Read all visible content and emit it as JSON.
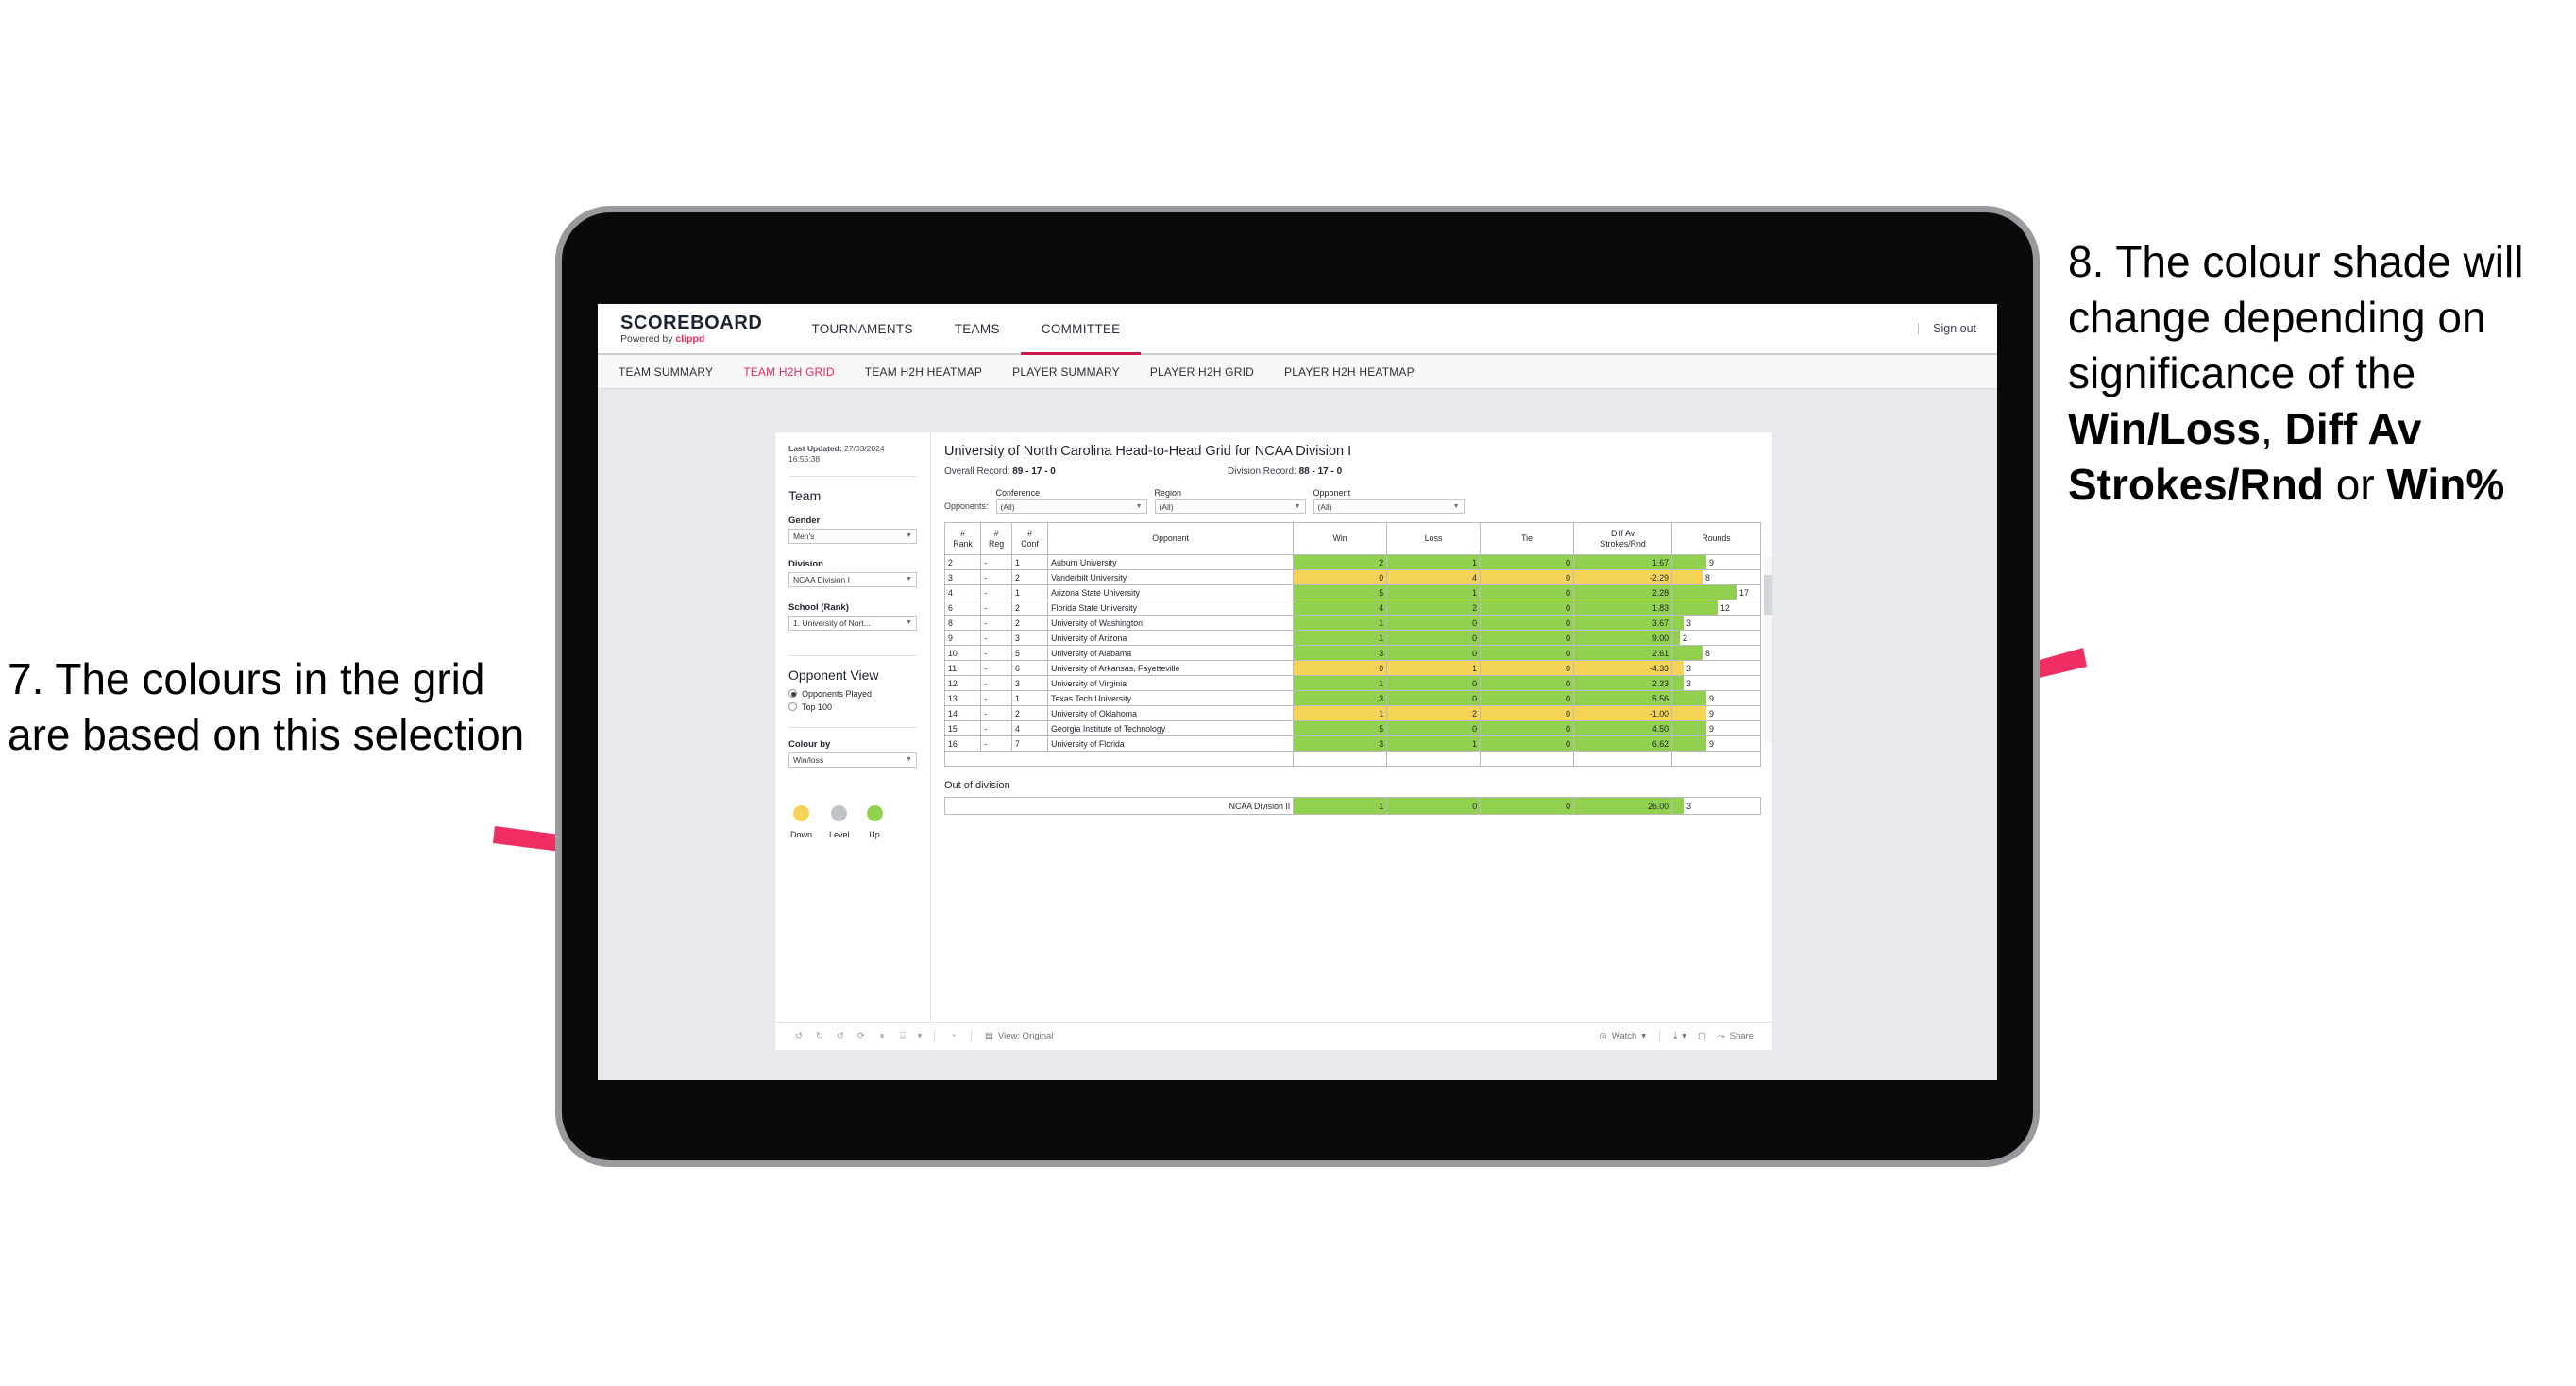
{
  "annotations": {
    "left": {
      "text": "7. The colours in the grid are based on this selection",
      "arrow_color": "#ef2e63"
    },
    "right": {
      "line1": "8. The colour shade will change depending on significance of the ",
      "bold1": "Win/Loss",
      "mid1": ", ",
      "bold2": "Diff Av Strokes/Rnd",
      "mid2": " or ",
      "bold3": "Win%",
      "arrow_color": "#ef2e63"
    }
  },
  "app": {
    "brand_title": "SCOREBOARD",
    "brand_sub_prefix": "Powered by ",
    "brand_sub_accent": "clippd",
    "accent_color": "#e8275a",
    "top_nav": [
      {
        "label": "TOURNAMENTS",
        "active": false
      },
      {
        "label": "TEAMS",
        "active": false
      },
      {
        "label": "COMMITTEE",
        "active": true
      }
    ],
    "sign_out": "Sign out",
    "sub_nav": [
      {
        "label": "TEAM SUMMARY",
        "active": false
      },
      {
        "label": "TEAM H2H GRID",
        "active": true
      },
      {
        "label": "TEAM H2H HEATMAP",
        "active": false
      },
      {
        "label": "PLAYER SUMMARY",
        "active": false
      },
      {
        "label": "PLAYER H2H GRID",
        "active": false
      },
      {
        "label": "PLAYER H2H HEATMAP",
        "active": false
      }
    ]
  },
  "filters": {
    "last_updated_label": "Last Updated: ",
    "last_updated_value": "27/03/2024 16:55:38",
    "team_heading": "Team",
    "gender_label": "Gender",
    "gender_value": "Men's",
    "division_label": "Division",
    "division_value": "NCAA Division I",
    "school_label": "School (Rank)",
    "school_value": "1. University of Nort...",
    "opponent_view_heading": "Opponent View",
    "opponent_view_options": [
      {
        "label": "Opponents Played",
        "selected": true
      },
      {
        "label": "Top 100",
        "selected": false
      }
    ],
    "colour_by_label": "Colour by",
    "colour_by_value": "Win/loss",
    "legend": [
      {
        "label": "Down",
        "color": "#f5d357"
      },
      {
        "label": "Level",
        "color": "#c0c3c7"
      },
      {
        "label": "Up",
        "color": "#92d050"
      }
    ]
  },
  "report": {
    "title": "University of North Carolina Head-to-Head Grid for NCAA Division I",
    "overall_record_label": "Overall Record: ",
    "overall_record_value": "89 - 17 - 0",
    "division_record_label": "Division Record: ",
    "division_record_value": "88 - 17 - 0",
    "opponents_label": "Opponents:",
    "opponent_filters": [
      {
        "label": "Conference",
        "value": "(All)"
      },
      {
        "label": "Region",
        "value": "(All)"
      },
      {
        "label": "Opponent",
        "value": "(All)"
      }
    ],
    "out_of_division_heading": "Out of division"
  },
  "chart_data": {
    "type": "table",
    "title": "University of North Carolina Head-to-Head Grid for NCAA Division I",
    "columns": [
      "# Rank",
      "# Reg",
      "# Conf",
      "Opponent",
      "Win",
      "Loss",
      "Tie",
      "Diff Av Strokes/Rnd",
      "Rounds"
    ],
    "column_headers_multiline": [
      [
        "#",
        "Rank"
      ],
      [
        "#",
        "Reg"
      ],
      [
        "#",
        "Conf"
      ],
      [
        "Opponent"
      ],
      [
        "Win"
      ],
      [
        "Loss"
      ],
      [
        "Tie"
      ],
      [
        "Diff Av",
        "Strokes/Rnd"
      ],
      [
        "Rounds"
      ]
    ],
    "rounds_max": 17,
    "rows": [
      {
        "rank": "2",
        "reg": "-",
        "conf": "1",
        "opponent": "Auburn University",
        "win": "2",
        "loss": "1",
        "tie": "0",
        "diff": "1.67",
        "rounds": "9",
        "state": "up"
      },
      {
        "rank": "3",
        "reg": "-",
        "conf": "2",
        "opponent": "Vanderbilt University",
        "win": "0",
        "loss": "4",
        "tie": "0",
        "diff": "-2.29",
        "rounds": "8",
        "state": "down"
      },
      {
        "rank": "4",
        "reg": "-",
        "conf": "1",
        "opponent": "Arizona State University",
        "win": "5",
        "loss": "1",
        "tie": "0",
        "diff": "2.28",
        "rounds": "17",
        "state": "up"
      },
      {
        "rank": "6",
        "reg": "-",
        "conf": "2",
        "opponent": "Florida State University",
        "win": "4",
        "loss": "2",
        "tie": "0",
        "diff": "1.83",
        "rounds": "12",
        "state": "up"
      },
      {
        "rank": "8",
        "reg": "-",
        "conf": "2",
        "opponent": "University of Washington",
        "win": "1",
        "loss": "0",
        "tie": "0",
        "diff": "3.67",
        "rounds": "3",
        "state": "up"
      },
      {
        "rank": "9",
        "reg": "-",
        "conf": "3",
        "opponent": "University of Arizona",
        "win": "1",
        "loss": "0",
        "tie": "0",
        "diff": "9.00",
        "rounds": "2",
        "state": "up"
      },
      {
        "rank": "10",
        "reg": "-",
        "conf": "5",
        "opponent": "University of Alabama",
        "win": "3",
        "loss": "0",
        "tie": "0",
        "diff": "2.61",
        "rounds": "8",
        "state": "up"
      },
      {
        "rank": "11",
        "reg": "-",
        "conf": "6",
        "opponent": "University of Arkansas, Fayetteville",
        "win": "0",
        "loss": "1",
        "tie": "0",
        "diff": "-4.33",
        "rounds": "3",
        "state": "down"
      },
      {
        "rank": "12",
        "reg": "-",
        "conf": "3",
        "opponent": "University of Virginia",
        "win": "1",
        "loss": "0",
        "tie": "0",
        "diff": "2.33",
        "rounds": "3",
        "state": "up"
      },
      {
        "rank": "13",
        "reg": "-",
        "conf": "1",
        "opponent": "Texas Tech University",
        "win": "3",
        "loss": "0",
        "tie": "0",
        "diff": "5.56",
        "rounds": "9",
        "state": "up"
      },
      {
        "rank": "14",
        "reg": "-",
        "conf": "2",
        "opponent": "University of Oklahoma",
        "win": "1",
        "loss": "2",
        "tie": "0",
        "diff": "-1.00",
        "rounds": "9",
        "state": "down"
      },
      {
        "rank": "15",
        "reg": "-",
        "conf": "4",
        "opponent": "Georgia Institute of Technology",
        "win": "5",
        "loss": "0",
        "tie": "0",
        "diff": "4.50",
        "rounds": "9",
        "state": "up"
      },
      {
        "rank": "16",
        "reg": "-",
        "conf": "7",
        "opponent": "University of Florida",
        "win": "3",
        "loss": "1",
        "tie": "0",
        "diff": "6.62",
        "rounds": "9",
        "state": "up"
      }
    ],
    "out_of_division_rows": [
      {
        "opponent": "NCAA Division II",
        "win": "1",
        "loss": "0",
        "tie": "0",
        "diff": "26.00",
        "rounds": "3",
        "state": "up"
      }
    ]
  },
  "toolbar": {
    "view_label": "View: Original",
    "watch_label": "Watch",
    "share_label": "Share"
  }
}
